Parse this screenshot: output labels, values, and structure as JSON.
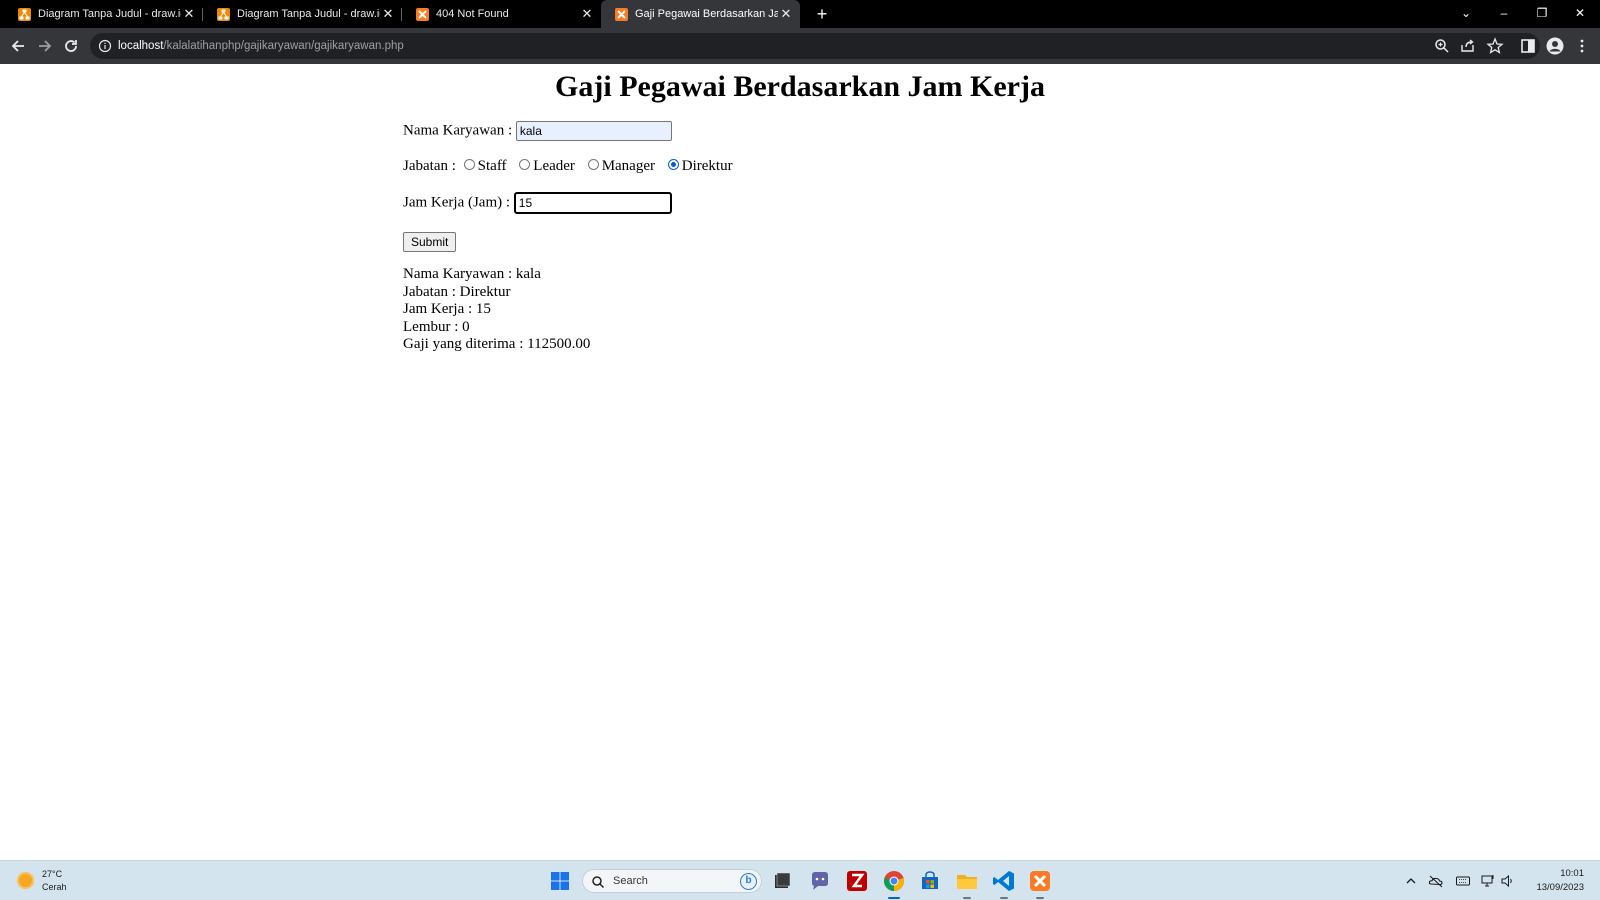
{
  "browser": {
    "tabs": [
      {
        "title": "Diagram Tanpa Judul - draw.io",
        "icon": "drawio-icon",
        "active": false
      },
      {
        "title": "Diagram Tanpa Judul - draw.io",
        "icon": "drawio-icon",
        "active": false
      },
      {
        "title": "404 Not Found",
        "icon": "xampp-icon",
        "active": false
      },
      {
        "title": "Gaji Pegawai Berdasarkan Jam Kerja",
        "icon": "xampp-icon",
        "active": true
      }
    ],
    "url_host": "localhost",
    "url_path": "/kalalatihanphp/gajikaryawan/gajikaryawan.php"
  },
  "page": {
    "title": "Gaji Pegawai Berdasarkan Jam Kerja",
    "form": {
      "name_label": "Nama Karyawan :",
      "name_value": "kala",
      "position_label": "Jabatan :",
      "positions": [
        "Staff",
        "Leader",
        "Manager",
        "Direktur"
      ],
      "selected_position": "Direktur",
      "hours_label": "Jam Kerja (Jam) :",
      "hours_value": "15",
      "submit_label": "Submit"
    },
    "result": {
      "name_line": "Nama Karyawan : kala",
      "position_line": "Jabatan : Direktur",
      "hours_line": "Jam Kerja : 15",
      "overtime_line": "Lembur : 0",
      "salary_line": "Gaji yang diterima : 112500.00"
    }
  },
  "taskbar": {
    "weather_temp": "27°C",
    "weather_condition": "Cerah",
    "search_placeholder": "Search",
    "apps": [
      "file-explorer-icon",
      "teams-chat-icon",
      "filezilla-icon",
      "chrome-icon",
      "store-icon",
      "folder-icon",
      "vscode-icon",
      "xampp-icon"
    ],
    "time": "10:01",
    "date": "13/09/2023"
  },
  "colors": {
    "tab_strip": "#000000",
    "toolbar": "#35363a",
    "taskbar": "#d4e4ef",
    "radio_accent": "#0b57d0"
  }
}
